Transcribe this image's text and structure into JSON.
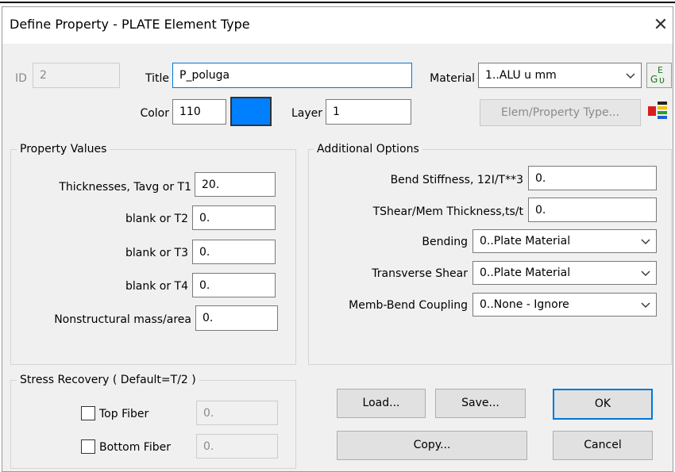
{
  "window": {
    "title": "Define Property - PLATE Element Type"
  },
  "header": {
    "id_label": "ID",
    "id_value": "2",
    "title_label": "Title",
    "title_value": "P_poluga",
    "material_label": "Material",
    "material_value": "1..ALU u mm",
    "color_label": "Color",
    "color_value": "110",
    "color_swatch": "#0080ff",
    "layer_label": "Layer",
    "layer_value": "1",
    "elem_property_type_label": "Elem/Property Type..."
  },
  "property_values": {
    "group_title": "Property Values",
    "fields": [
      {
        "label": "Thicknesses, Tavg or T1",
        "value": "20."
      },
      {
        "label": "blank or T2",
        "value": "0."
      },
      {
        "label": "blank or T3",
        "value": "0."
      },
      {
        "label": "blank or T4",
        "value": "0."
      },
      {
        "label": "Nonstructural mass/area",
        "value": "0."
      }
    ]
  },
  "additional_options": {
    "group_title": "Additional Options",
    "bend_stiffness_label": "Bend Stiffness,  12I/T**3",
    "bend_stiffness_value": "0.",
    "tshear_label": "TShear/Mem Thickness,ts/t",
    "tshear_value": "0.",
    "bending_label": "Bending",
    "bending_value": "0..Plate Material",
    "transverse_shear_label": "Transverse Shear",
    "transverse_shear_value": "0..Plate Material",
    "memb_bend_label": "Memb-Bend Coupling",
    "memb_bend_value": "0..None - Ignore"
  },
  "stress_recovery": {
    "group_title": "Stress Recovery ( Default=T/2 )",
    "top_fiber_label": "Top Fiber",
    "top_fiber_value": "0.",
    "bottom_fiber_label": "Bottom Fiber",
    "bottom_fiber_value": "0."
  },
  "buttons": {
    "load": "Load...",
    "save": "Save...",
    "ok": "OK",
    "copy": "Copy...",
    "cancel": "Cancel"
  },
  "colors": {
    "accent": "#0078d7",
    "dialog_bg": "#f0f0f0"
  }
}
